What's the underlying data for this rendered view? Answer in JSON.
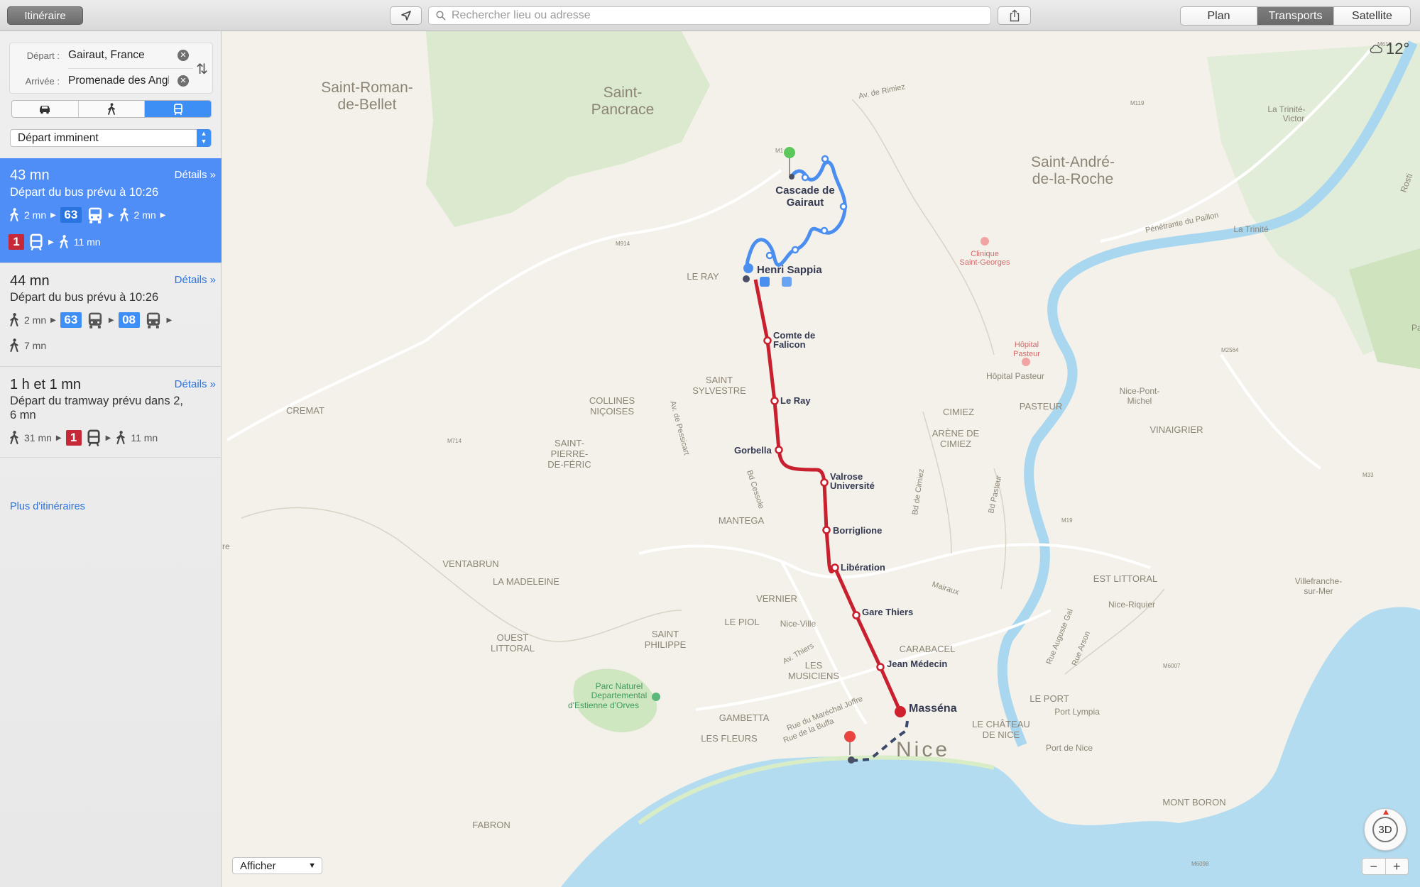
{
  "toolbar": {
    "itinerary_button": "Itinéraire",
    "search_placeholder": "Rechercher lieu ou adresse",
    "map_modes": [
      "Plan",
      "Transports",
      "Satellite"
    ],
    "active_mode": "Transports"
  },
  "route": {
    "depart_label": "Départ :",
    "depart_value": "Gairaut, France",
    "arrive_label": "Arrivée :",
    "arrive_value": "Promenade des Anglais",
    "travel_modes": [
      "car",
      "walk",
      "transit"
    ],
    "active_travel_mode": "transit",
    "departure_option": "Départ imminent"
  },
  "options": [
    {
      "duration": "43 mn",
      "details": "Détails »",
      "subtitle": "Départ du bus prévu à 10:26",
      "steps_line1": {
        "walk1": "2 mn",
        "bus": "63",
        "walk2": "2 mn"
      },
      "steps_line2": {
        "tram": "1",
        "walk": "11 mn"
      }
    },
    {
      "duration": "44 mn",
      "details": "Détails »",
      "subtitle": "Départ du bus prévu à 10:26",
      "steps_line1": {
        "walk1": "2 mn",
        "bus1": "63",
        "bus2": "08"
      },
      "steps_line2": {
        "walk": "7 mn"
      }
    },
    {
      "duration": "1 h et 1 mn",
      "details": "Détails »",
      "subtitle_line1": "Départ du tramway prévu dans 2,",
      "subtitle_line2": "6 mn",
      "steps_line1": {
        "walk1": "31 mn",
        "tram": "1",
        "walk2": "11 mn"
      }
    }
  ],
  "more_routes": "Plus d'itinéraires",
  "map": {
    "weather": "12°",
    "compass_label": "3D",
    "afficher": "Afficher",
    "zoom_out": "−",
    "zoom_in": "+",
    "colors": {
      "tram": "#c8202f",
      "bus": "#4a8ef0",
      "water": "#b3dcf1",
      "park": "#cfe7c0",
      "land": "#f4f1ea"
    },
    "places": {
      "saint_roman_1": "Saint-Roman-",
      "saint_roman_2": "de-Bellet",
      "saint_pancrace_1": "Saint-",
      "saint_pancrace_2": "Pancrace",
      "saint_andre_1": "Saint-André-",
      "saint_andre_2": "de-la-Roche",
      "le_ray": "LE RAY",
      "saint_sylvestre_1": "SAINT",
      "saint_sylvestre_2": "SYLVESTRE",
      "collines_1": "COLLINES",
      "collines_2": "NIÇOISES",
      "cremat": "CREMAT",
      "saint_pierre_1": "SAINT-",
      "saint_pierre_2": "PIERRE-",
      "saint_pierre_3": "DE-FÉRIC",
      "mantega": "MANTEGA",
      "cimiez": "CIMIEZ",
      "arene_1": "ARÈNE DE",
      "arene_2": "CIMIEZ",
      "pasteur": "PASTEUR",
      "vinaigrier": "VINAIGRIER",
      "ventabrun": "VENTABRUN",
      "la_madeleine": "LA MADELEINE",
      "vernier": "VERNIER",
      "le_piol": "LE PIOL",
      "ouest_1": "OUEST",
      "ouest_2": "LITTORAL",
      "saint_philippe_1": "SAINT",
      "saint_philippe_2": "PHILIPPE",
      "les_musiciens_1": "LES",
      "les_musiciens_2": "MUSICIENS",
      "carabacel": "CARABACEL",
      "est_littoral": "EST LITTORAL",
      "le_port": "LE PORT",
      "chateau_1": "LE CHÂTEAU",
      "chateau_2": "DE NICE",
      "gambetta": "GAMBETTA",
      "les_fleurs": "LES FLEURS",
      "fabron": "FABRON",
      "mont_boron": "MONT BORON",
      "nice": "Nice",
      "nice_ville": "Nice-Ville",
      "nice_riquier": "Nice-Riquier",
      "nice_pont_1": "Nice-Pont-",
      "nice_pont_2": "Michel",
      "port_lympia": "Port Lympia",
      "port_de_nice": "Port de Nice",
      "villefranche_1": "Villefranche-",
      "villefranche_2": "sur-Mer",
      "la_trinite": "La Trinité",
      "la_trinite_victor_1": "La Trinité-",
      "la_trinite_victor_2": "Victor",
      "hopital_1": "Hôpital",
      "hopital_2": "Pasteur",
      "hopital_3": "Hôpital Pasteur",
      "clinique_1": "Clinique",
      "clinique_2": "Saint-Georges",
      "parc_1": "Parc Naturel",
      "parc_2": "Departemental",
      "parc_3": "d'Estienne d'Orves",
      "falicon": "Falicon",
      "re": "re",
      "pa": "Pa",
      "rosti": "Rosti"
    },
    "roads": {
      "rimiez": "Av. de Rimiez",
      "pessicart": "Av. de Pessicart",
      "cessole": "Bd Cessole",
      "cimiez_bd": "Bd de Cimiez",
      "pasteur_bd": "Bd Pasteur",
      "penetrante": "Pénétrante du Paillon",
      "mairaux": "Mairaux",
      "thiers": "Av. Thiers",
      "marechal": "Rue du Maréchal Joffre",
      "buffa": "Rue de la Buffa",
      "gal": "Rue Auguste Gal",
      "arson": "Rue Arson",
      "m914": "M914",
      "m714": "M714",
      "m119": "M119",
      "m619": "M619",
      "m2564": "M2564",
      "m33": "M33",
      "m19": "M19",
      "m6007": "M6007",
      "m6098": "M6098",
      "m1": "M1"
    },
    "stops": {
      "cascade_1": "Cascade de",
      "cascade_2": "Gairaut",
      "henri_sappia": "Henri Sappia",
      "comte_1": "Comte de",
      "comte_2": "Falicon",
      "le_ray": "Le Ray",
      "gorbella": "Gorbella",
      "valrose_1": "Valrose",
      "valrose_2": "Université",
      "borriglione": "Borriglione",
      "liberation": "Libération",
      "gare_thiers": "Gare Thiers",
      "jean_medecin": "Jean Médecin",
      "massena": "Masséna"
    }
  }
}
